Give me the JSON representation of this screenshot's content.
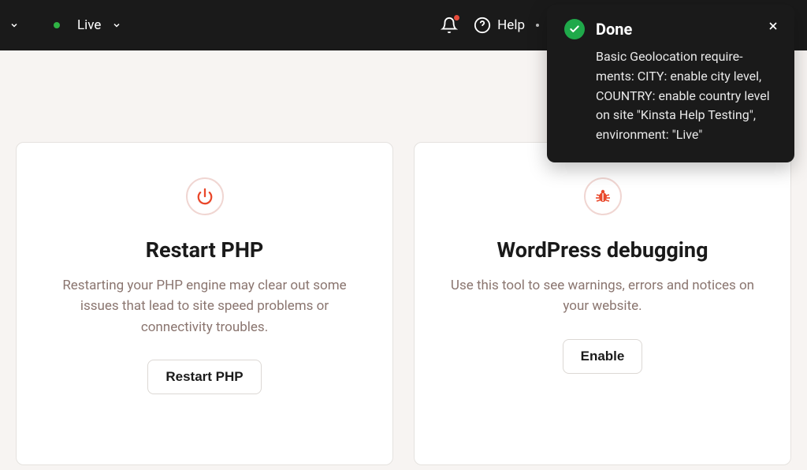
{
  "header": {
    "env_label": "Live",
    "help_label": "Help"
  },
  "toast": {
    "title": "Done",
    "body": "Basic Geolocation require­ments: CITY: enable city level, COUNTRY: enable country level on site \"Kinsta Help Testing\", environment: \"Live\""
  },
  "cards": {
    "restart_php": {
      "title": "Restart PHP",
      "desc": "Restarting your PHP engine may clear out some issues that lead to site speed problems or connectivity troubles.",
      "button": "Restart PHP"
    },
    "wp_debug": {
      "title": "WordPress debugging",
      "desc": "Use this tool to see warnings, errors and notices on your website.",
      "button": "Enable"
    }
  }
}
